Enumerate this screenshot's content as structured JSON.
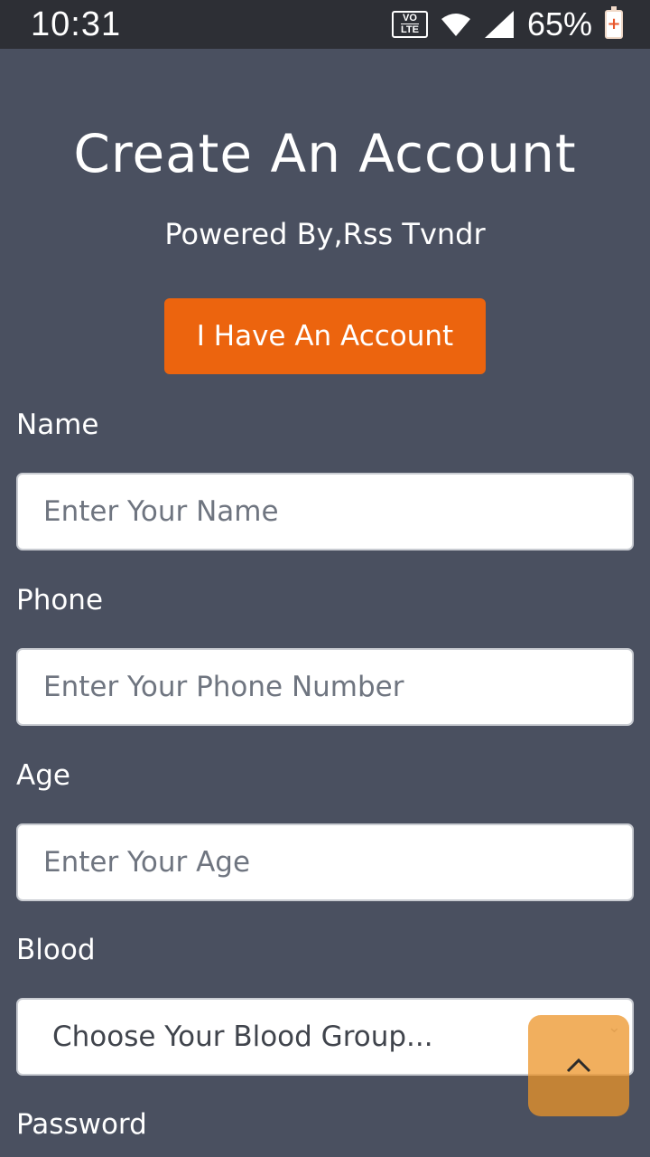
{
  "status_bar": {
    "time": "10:31",
    "volte_top": "VO",
    "volte_bottom": "LTE",
    "battery_percent": "65%",
    "icons": [
      "volte-icon",
      "wifi-icon",
      "signal-icon",
      "battery-charging-icon"
    ]
  },
  "header": {
    "title": "Create An Account",
    "subtitle": "Powered By,Rss Tvndr",
    "login_button": "I Have An Account"
  },
  "form": {
    "name": {
      "label": "Name",
      "placeholder": "Enter Your Name"
    },
    "phone": {
      "label": "Phone",
      "placeholder": "Enter Your Phone Number"
    },
    "age": {
      "label": "Age",
      "placeholder": "Enter Your Age"
    },
    "blood": {
      "label": "Blood",
      "selected": "Choose Your Blood Group..."
    },
    "password": {
      "label": "Password"
    }
  },
  "colors": {
    "background": "#4a5060",
    "status_bar": "#2d2f35",
    "accent": "#ec640e",
    "scroll_button": "#ec9428"
  },
  "scroll_top_icon": "chevron-up-icon"
}
